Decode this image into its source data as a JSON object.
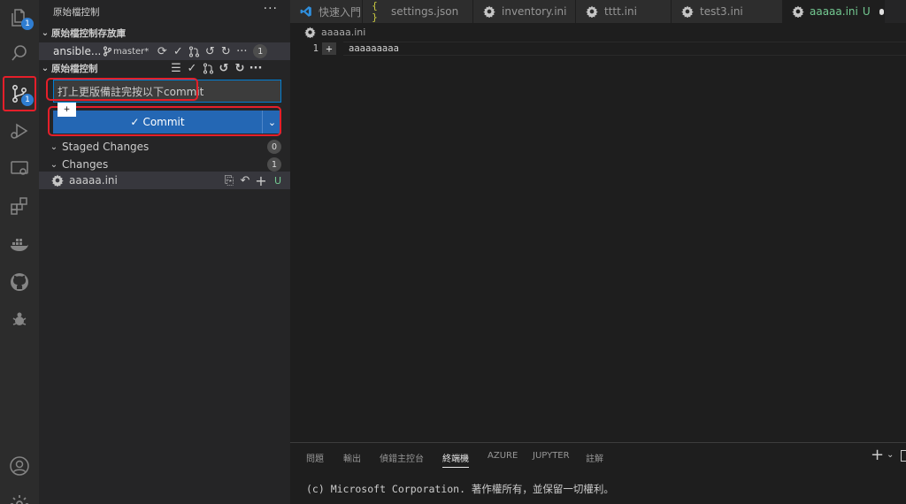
{
  "activity_bar": {
    "explorer_badge": "1",
    "scm_badge": "1"
  },
  "sidebar": {
    "title": "原始檔控制",
    "more": "···",
    "repositories_header": "原始檔控制存放庫",
    "repo": {
      "name": "ansible...",
      "branch": "master*",
      "count": "1"
    },
    "scm_header": "原始檔控制",
    "commit_message": "打上更版備註完按以下commit",
    "commit_button": "Commit",
    "tooltip": "+",
    "staged_label": "Staged Changes",
    "staged_count": "0",
    "changes_label": "Changes",
    "changes_count": "1",
    "file": {
      "name": "aaaaa.ini",
      "status": "U"
    }
  },
  "tabs": [
    {
      "label": "快速入門"
    },
    {
      "label": "settings.json"
    },
    {
      "label": "inventory.ini"
    },
    {
      "label": "tttt.ini"
    },
    {
      "label": "test3.ini"
    },
    {
      "label": "aaaaa.ini",
      "status": "U"
    }
  ],
  "editor": {
    "breadcrumb": "aaaaa.ini",
    "line_number": "1",
    "line_text": "aaaaaaaaa"
  },
  "panel": {
    "tabs": [
      "問題",
      "輸出",
      "偵錯主控台",
      "終端機",
      "AZURE",
      "JUPYTER",
      "註解"
    ],
    "active_tab": "終端機",
    "terminal_line": "(c) Microsoft Corporation. 著作權所有，並保留一切權利。"
  },
  "colors": {
    "accent": "#2467b4",
    "highlight": "#e51f2a",
    "untracked": "#73c991"
  }
}
